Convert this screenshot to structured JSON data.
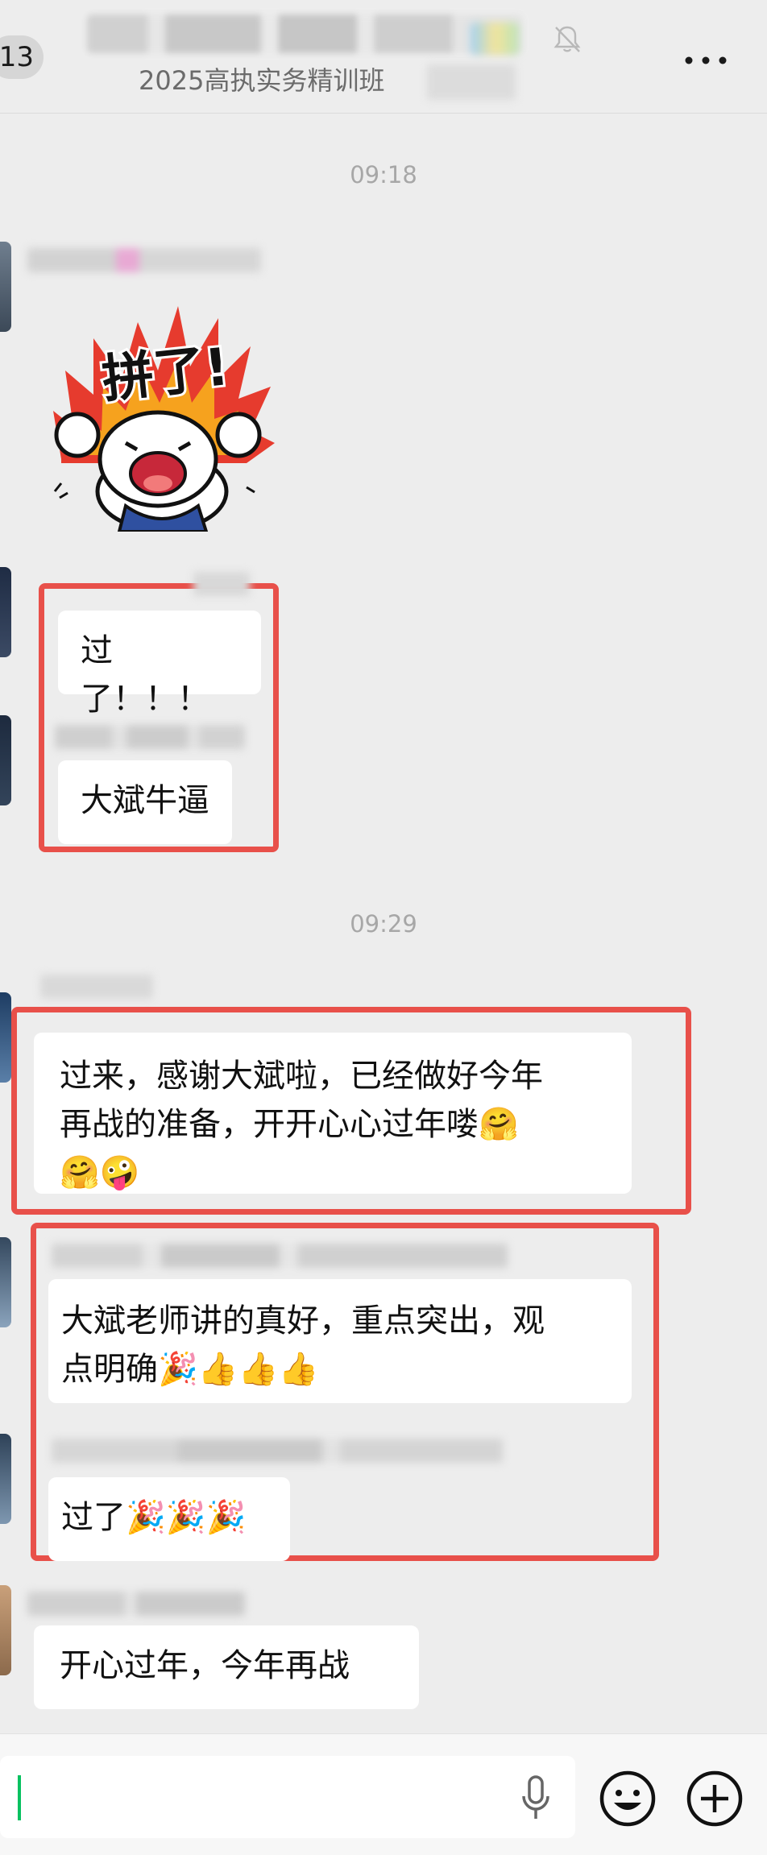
{
  "header": {
    "unread_count": "13",
    "subtitle": "2025高执实务精训班"
  },
  "timestamps": [
    "09:18",
    "09:29"
  ],
  "sticker": {
    "text": "拼了!"
  },
  "messages": [
    {
      "text": "过了！！！"
    },
    {
      "text": "大斌牛逼"
    },
    {
      "line1": "过来，感谢大斌啦，已经做好今年",
      "line2": "再战的准备，开开心心过年喽"
    },
    {
      "line1": "大斌老师讲的真好，重点突出，观",
      "line2": "点明确"
    },
    {
      "text": "过了"
    },
    {
      "text": "开心过年，今年再战"
    }
  ],
  "emoji": {
    "hug": "🤗",
    "party": "🎉",
    "thumbs": "👍",
    "sweat": "🤪"
  },
  "colors": {
    "background": "#ededed",
    "bubble": "#ffffff",
    "highlight_box": "#e8504a",
    "cursor": "#07c160"
  }
}
